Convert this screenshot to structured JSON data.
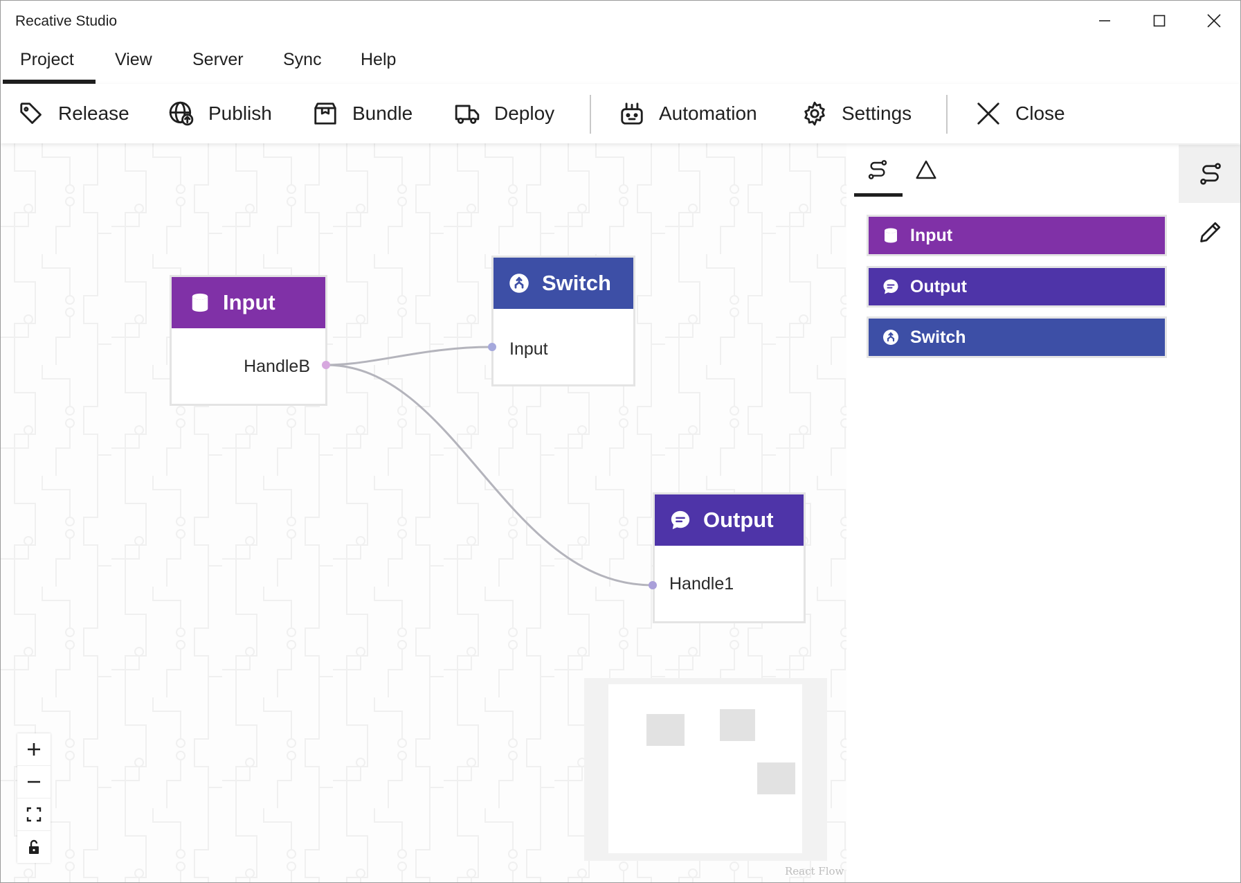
{
  "window": {
    "title": "Recative Studio"
  },
  "menu": {
    "items": [
      {
        "label": "Project",
        "active": true
      },
      {
        "label": "View"
      },
      {
        "label": "Server"
      },
      {
        "label": "Sync"
      },
      {
        "label": "Help"
      }
    ]
  },
  "toolbar": {
    "release_label": "Release",
    "publish_label": "Publish",
    "bundle_label": "Bundle",
    "deploy_label": "Deploy",
    "automation_label": "Automation",
    "settings_label": "Settings",
    "close_label": "Close"
  },
  "canvas": {
    "nodes": {
      "input": {
        "title": "Input",
        "handle": "HandleB",
        "color": "#8031a7",
        "icon": "database-icon"
      },
      "switch": {
        "title": "Switch",
        "handle": "Input",
        "color": "#3d4fa6",
        "icon": "switch-icon"
      },
      "output": {
        "title": "Output",
        "handle": "Handle1",
        "color": "#4e34a8",
        "icon": "chat-icon"
      }
    },
    "edge_color": "#b4b4bc",
    "attribution": "React Flow"
  },
  "palette": {
    "tabs": [
      {
        "icon": "route-icon",
        "active": true
      },
      {
        "icon": "triangle-icon",
        "active": false
      }
    ],
    "items": [
      {
        "label": "Input",
        "color": "#8031a7",
        "icon": "database-icon"
      },
      {
        "label": "Output",
        "color": "#4e34a8",
        "icon": "chat-icon"
      },
      {
        "label": "Switch",
        "color": "#3d4fa6",
        "icon": "switch-icon"
      }
    ]
  },
  "rail": {
    "items": [
      {
        "icon": "route-icon",
        "active": true
      },
      {
        "icon": "pencil-icon",
        "active": false
      }
    ]
  }
}
